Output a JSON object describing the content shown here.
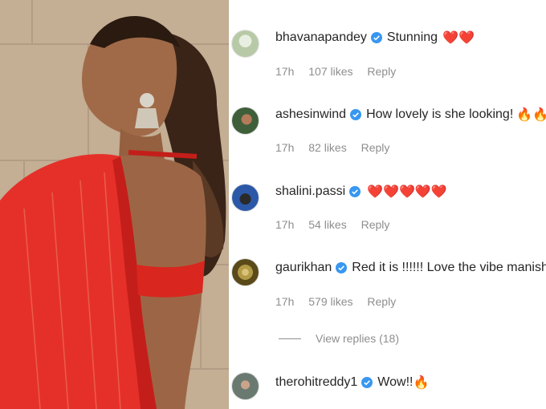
{
  "comments": [
    {
      "username": "bhavanapandey",
      "text": "Stunning",
      "emoji": "❤️❤️",
      "time": "17h",
      "likes": "107 likes",
      "reply": "Reply",
      "avatar_color": "#b7c9a6"
    },
    {
      "username": "ashesinwind",
      "text": "How lovely is she looking!",
      "emoji": "🔥🔥",
      "time": "17h",
      "likes": "82 likes",
      "reply": "Reply",
      "avatar_color": "#3f5f3a"
    },
    {
      "username": "shalini.passi",
      "text": "",
      "emoji": "❤️❤️❤️❤️❤️",
      "time": "17h",
      "likes": "54 likes",
      "reply": "Reply",
      "avatar_color": "#2c58a8"
    },
    {
      "username": "gaurikhan",
      "text": "Red it is !!!!!! Love the vibe manish",
      "emoji": "",
      "time": "17h",
      "likes": "579 likes",
      "reply": "Reply",
      "avatar_color": "#8a7a3a"
    },
    {
      "username": "therohitreddy1",
      "text": "Wow!!",
      "emoji": "🔥",
      "time": "",
      "likes": "",
      "reply": "",
      "avatar_color": "#6b7a70"
    }
  ],
  "view_replies": "View replies (18)",
  "colors": {
    "verified": "#3897f0",
    "meta": "#8e8e8e",
    "text": "#262626",
    "heart": "#e0202a"
  },
  "icons": {
    "verified": "verified-badge-icon",
    "heart": "red-heart-icon",
    "fire": "fire-icon"
  }
}
